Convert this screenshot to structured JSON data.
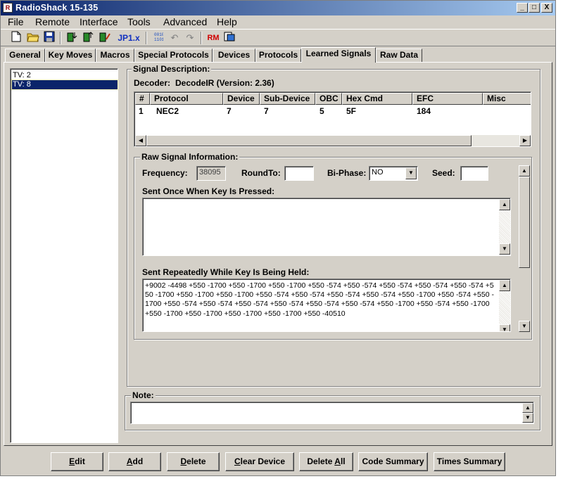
{
  "window": {
    "title": "RadioShack 15-135",
    "minimize": "_",
    "maximize": "□",
    "close": "X",
    "app_icon_text": "R"
  },
  "menu": [
    "File",
    "Remote",
    "Interface",
    "Tools",
    "Advanced",
    "Help"
  ],
  "toolbar": {
    "jp_label": "JP1.x",
    "rm_label": "RM"
  },
  "tabs": [
    "General",
    "Key Moves",
    "Macros",
    "Special Protocols",
    "Devices",
    "Protocols",
    "Learned Signals",
    "Raw Data"
  ],
  "active_tab": "Learned Signals",
  "signals": [
    "TV: 2",
    "TV: 8"
  ],
  "signal_description": {
    "legend": "Signal Description:",
    "decoder_label": "Decoder:",
    "decoder_value": "DecodeIR (Version: 2.36)",
    "columns": [
      "#",
      "Protocol",
      "Device",
      "Sub-Device",
      "OBC",
      "Hex Cmd",
      "EFC",
      "Misc"
    ],
    "rows": [
      [
        "1",
        "NEC2",
        "7",
        "7",
        "5",
        "5F",
        "184",
        ""
      ]
    ]
  },
  "raw_signal": {
    "legend": "Raw Signal Information:",
    "frequency_label": "Frequency:",
    "frequency_value": "38095",
    "roundto_label": "RoundTo:",
    "roundto_value": "",
    "biphase_label": "Bi-Phase:",
    "biphase_value": "NO",
    "seed_label": "Seed:",
    "seed_value": "",
    "once_label": "Sent Once When Key Is Pressed:",
    "once_value": "",
    "repeat_label": "Sent Repeatedly While Key Is Being Held:",
    "repeat_value": "+9002 -4498 +550 -1700 +550 -1700 +550 -1700 +550 -574 +550 -574 +550 -574 +550 -574 +550 -574 +550 -1700 +550 -1700 +550 -1700 +550 -574 +550 -574 +550 -574 +550 -574 +550 -1700 +550 -574 +550 -1700 +550 -574 +550 -574 +550 -574 +550 -574 +550 -574 +550 -574 +550 -1700 +550 -574 +550 -1700 +550 -1700 +550 -1700 +550 -1700 +550 -1700 +550 -40510"
  },
  "note": {
    "legend": "Note:",
    "value": ""
  },
  "buttons": {
    "edit": {
      "mnemonic": "E",
      "rest": "dit"
    },
    "add": {
      "mnemonic": "A",
      "rest": "dd"
    },
    "delete": {
      "mnemonic": "D",
      "rest": "elete"
    },
    "clear_device": {
      "mnemonic": "C",
      "rest": "lear Device"
    },
    "delete_all": {
      "prefix": "Delete ",
      "mnemonic": "A",
      "rest": "ll"
    },
    "code_summary": "Code Summary",
    "times_summary": "Times Summary"
  }
}
